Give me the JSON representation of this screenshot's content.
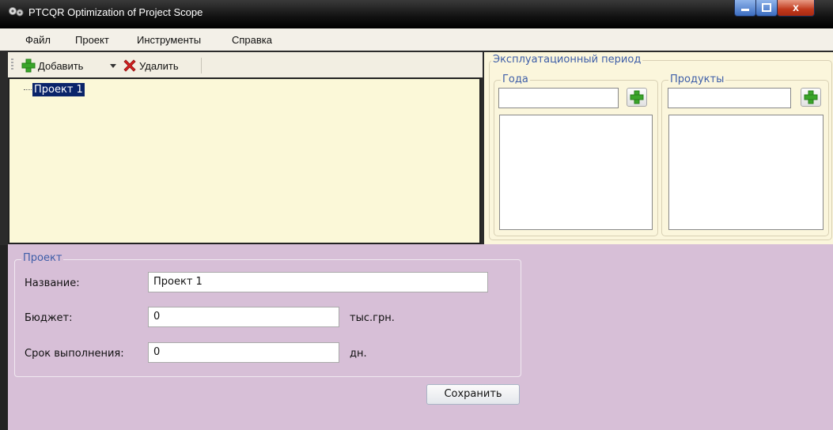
{
  "window": {
    "title": "PTCQR Optimization of Project Scope",
    "minimize_glyph": "",
    "maximize_glyph": "",
    "close_glyph": "x"
  },
  "menu": [
    "Файл",
    "Проект",
    "Инструменты",
    "Справка"
  ],
  "toolbar": {
    "add_label": "Добавить",
    "delete_label": "Удалить",
    "add_icon": "green-plus-icon",
    "delete_icon": "red-x-icon",
    "dropdown_icon": "chevron-down-icon"
  },
  "tree": {
    "selected_node": "Проект 1"
  },
  "operation_period": {
    "title": "Эксплуатационный период",
    "years": {
      "title": "Года",
      "input_value": "",
      "add_icon": "green-plus-icon"
    },
    "products": {
      "title": "Продукты",
      "input_value": "",
      "add_icon": "green-plus-icon"
    }
  },
  "project_form": {
    "group_title": "Проект",
    "name_label": "Название:",
    "name_value": "Проект 1",
    "budget_label": "Бюджет:",
    "budget_value": "0",
    "budget_unit": "тыс.грн.",
    "duration_label": "Срок выполнения:",
    "duration_value": "0",
    "duration_unit": "дн.",
    "save_label": "Сохранить"
  },
  "colors": {
    "tree_background": "#fbf8d8",
    "panel_background": "#fbf6dc",
    "form_background": "#d7bfd7",
    "group_title": "#3e5ea8",
    "selection": "#0a246a"
  }
}
